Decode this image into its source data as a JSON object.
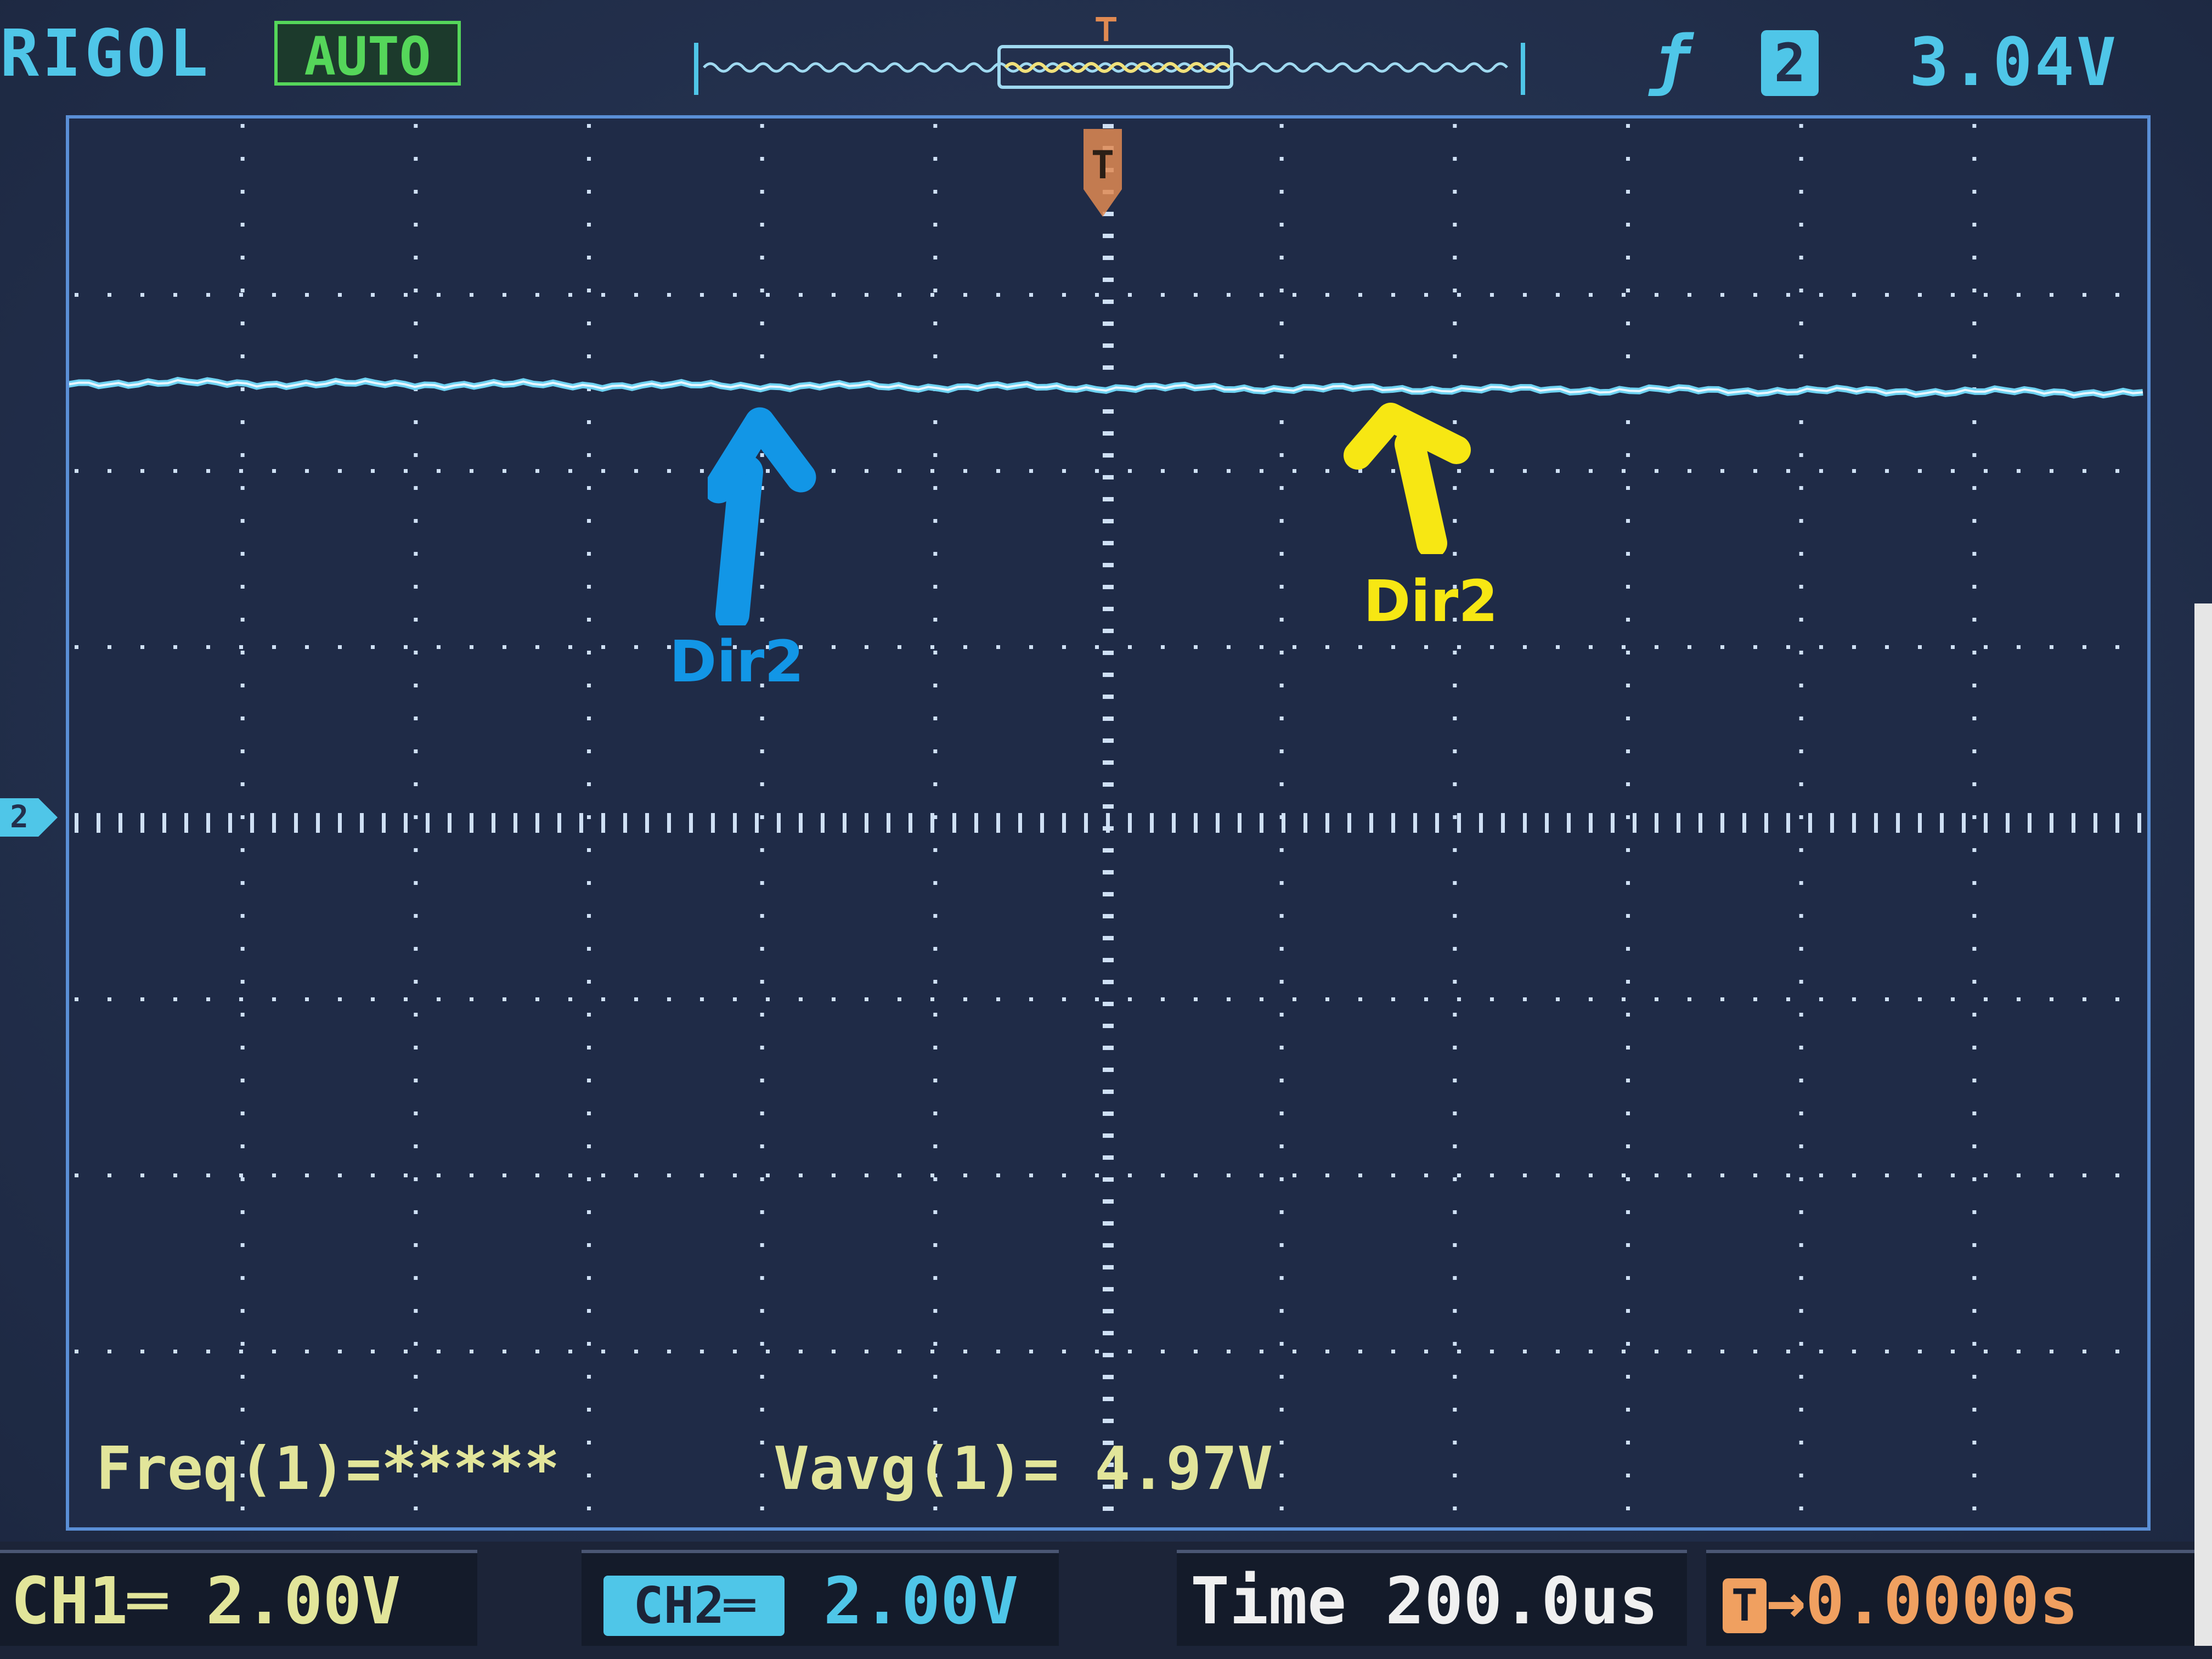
{
  "top_bar": {
    "brand": "RIGOL",
    "run_status": "AUTO",
    "trigger_slope_icon": "rising-edge-icon",
    "trigger_source": "2",
    "trigger_level": "3.04V"
  },
  "waveform": {
    "channel2_level_divisions_above_center": 2.5,
    "trace_color": "#6fd3f2"
  },
  "annotations": {
    "blue_label": "Dir2",
    "blue_color": "#1296e6",
    "yellow_label": "Dir2",
    "yellow_color": "#f7e713"
  },
  "measurements": {
    "freq": "Freq(1)=*****",
    "vavg": "Vavg(1)= 4.97V"
  },
  "bottom_bar": {
    "ch1": "CH1═ 2.00V",
    "ch2_tag": "CH2═",
    "ch2_scale": "2.00V",
    "time": "Time 200.0us",
    "offset_icon": "T",
    "offset": "→0.0000s"
  },
  "colors": {
    "cyan": "#4fc6e8",
    "green_status": "#55d65a",
    "measurement_text": "#e2e59a",
    "offset_orange": "#f0a060"
  }
}
